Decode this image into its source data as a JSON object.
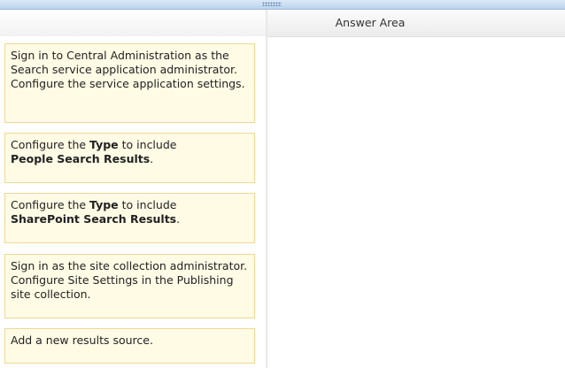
{
  "answer_area": {
    "title": "Answer Area"
  },
  "cards": [
    {
      "text": "Sign in to Central Administration as the Search service application administrator. Configure the service application settings."
    },
    {
      "pre": "Configure the ",
      "bold1": "Type",
      "mid": " to include ",
      "bold2": "People Search Results",
      "post": "."
    },
    {
      "pre": "Configure the ",
      "bold1": "Type",
      "mid": " to include ",
      "bold2": "SharePoint Search Results",
      "post": "."
    },
    {
      "text": "Sign in as the site collection administrator. Configure Site Settings in the Publishing site collection."
    },
    {
      "text": "Add a new results source."
    }
  ],
  "colors": {
    "card_background": "#fffbe5",
    "card_border": "#f0d794",
    "top_bar": "#bcd3ee"
  }
}
